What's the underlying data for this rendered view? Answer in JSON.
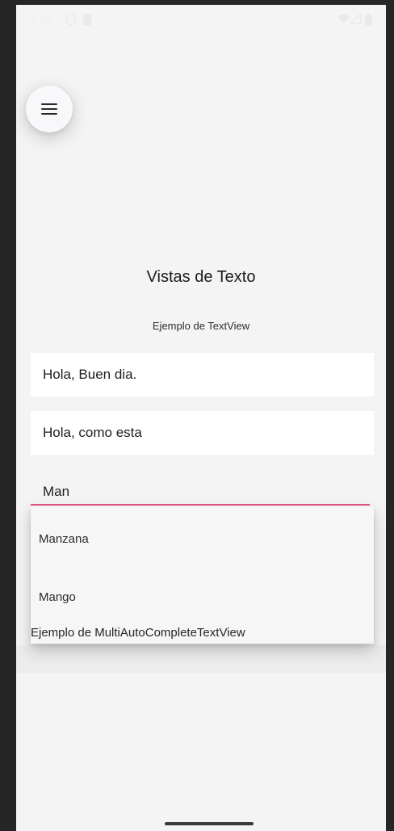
{
  "statusbar": {
    "time": "5:45"
  },
  "menu": {
    "icon": "hamburger-menu-icon"
  },
  "title": "Vistas de Texto",
  "subtitle": "Ejemplo de TextView",
  "fields": {
    "first": "Hola, Buen dia.",
    "second": "Hola, como esta"
  },
  "autocomplete": {
    "value": "Man",
    "underline_color": "#e5558a"
  },
  "dropdown": {
    "items": [
      "Manzana",
      "Mango"
    ],
    "footer": "Ejemplo de MultiAutoCompleteTextView"
  },
  "colors": {
    "screen_bg": "#f4f4f4",
    "field_bg": "#ffffff",
    "accent": "#e5558a"
  }
}
